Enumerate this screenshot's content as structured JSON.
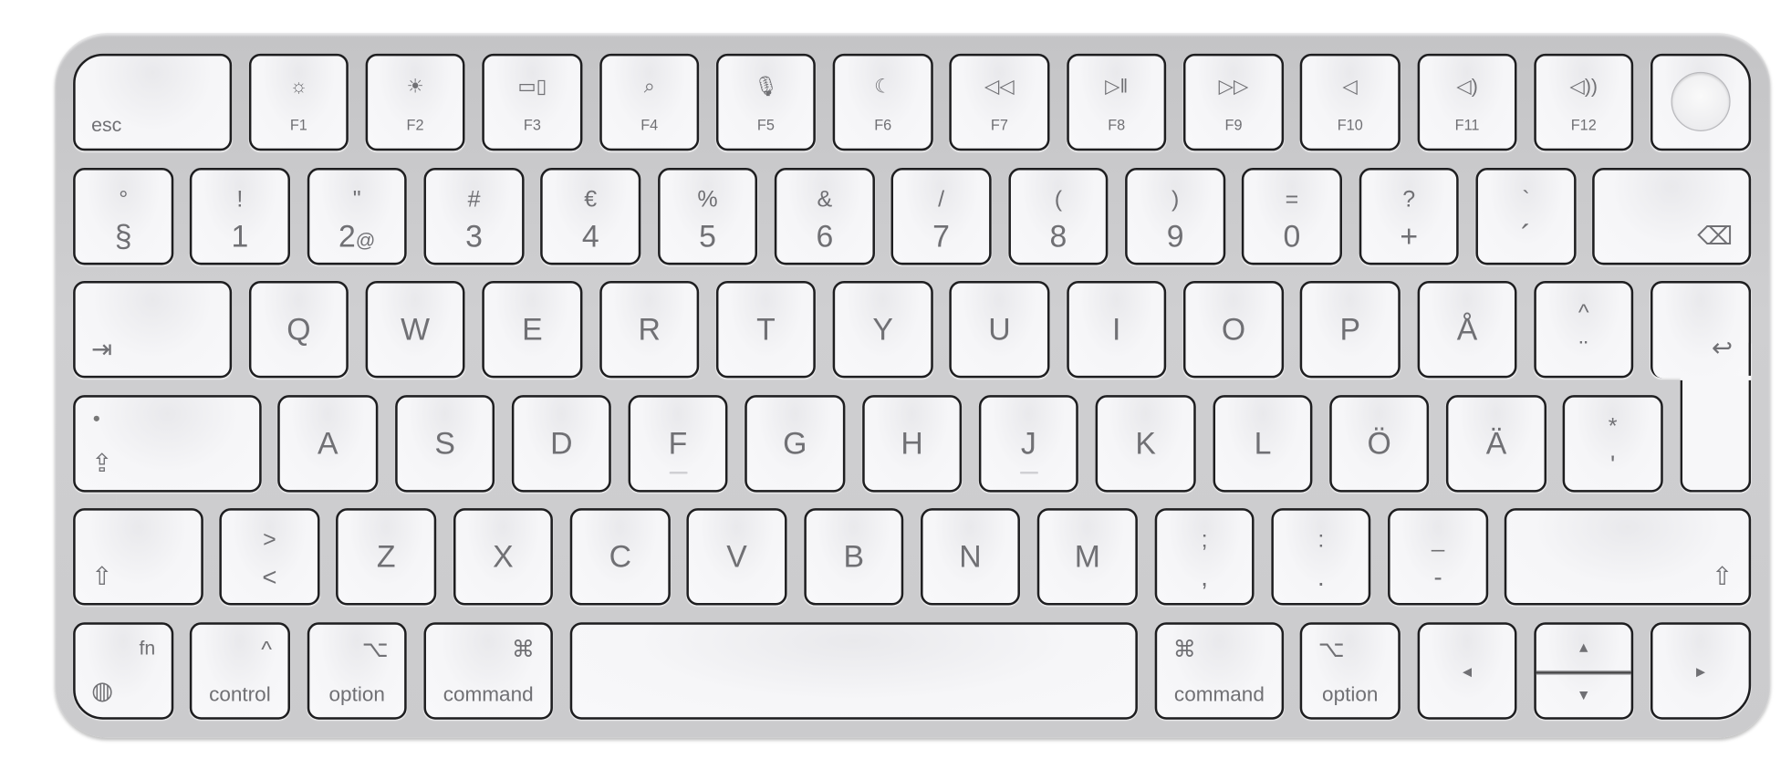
{
  "keyboard": {
    "layout": "Swedish",
    "colors": {
      "body": "#c9c9cb",
      "key": "#f6f6f8",
      "key_border": "#1e1e20",
      "legend": "#707074"
    },
    "rows": [
      {
        "keys": [
          {
            "label": "esc"
          },
          {
            "icon": "brightness-down-icon",
            "fn": "F1"
          },
          {
            "icon": "brightness-up-icon",
            "fn": "F2"
          },
          {
            "icon": "mission-control-icon",
            "fn": "F3"
          },
          {
            "icon": "search-icon",
            "fn": "F4"
          },
          {
            "icon": "microphone-icon",
            "fn": "F5"
          },
          {
            "icon": "moon-icon",
            "fn": "F6"
          },
          {
            "icon": "rewind-icon",
            "fn": "F7"
          },
          {
            "icon": "play-pause-icon",
            "fn": "F8"
          },
          {
            "icon": "fast-forward-icon",
            "fn": "F9"
          },
          {
            "icon": "mute-icon",
            "fn": "F10"
          },
          {
            "icon": "volume-down-icon",
            "fn": "F11"
          },
          {
            "icon": "volume-up-icon",
            "fn": "F12"
          },
          {
            "icon": "touch-id-icon"
          }
        ]
      },
      {
        "keys": [
          {
            "shift": "°",
            "main": "§"
          },
          {
            "shift": "!",
            "main": "1"
          },
          {
            "shift": "\"",
            "main": "2",
            "alt": "@"
          },
          {
            "shift": "#",
            "main": "3"
          },
          {
            "shift": "€",
            "main": "4"
          },
          {
            "shift": "%",
            "main": "5"
          },
          {
            "shift": "&",
            "main": "6"
          },
          {
            "shift": "/",
            "main": "7"
          },
          {
            "shift": "(",
            "main": "8"
          },
          {
            "shift": ")",
            "main": "9"
          },
          {
            "shift": "=",
            "main": "0"
          },
          {
            "shift": "?",
            "main": "+"
          },
          {
            "shift": "`",
            "main": "´"
          },
          {
            "icon": "backspace-icon"
          }
        ]
      },
      {
        "keys": [
          {
            "icon": "tab-icon"
          },
          {
            "letter": "Q"
          },
          {
            "letter": "W"
          },
          {
            "letter": "E"
          },
          {
            "letter": "R"
          },
          {
            "letter": "T"
          },
          {
            "letter": "Y"
          },
          {
            "letter": "U"
          },
          {
            "letter": "I"
          },
          {
            "letter": "O"
          },
          {
            "letter": "P"
          },
          {
            "letter": "Å"
          },
          {
            "shift": "^",
            "main": "¨"
          },
          {
            "icon": "return-icon"
          }
        ]
      },
      {
        "keys": [
          {
            "icon": "caps-lock-icon"
          },
          {
            "letter": "A"
          },
          {
            "letter": "S"
          },
          {
            "letter": "D"
          },
          {
            "letter": "F"
          },
          {
            "letter": "G"
          },
          {
            "letter": "H"
          },
          {
            "letter": "J"
          },
          {
            "letter": "K"
          },
          {
            "letter": "L"
          },
          {
            "letter": "Ö"
          },
          {
            "letter": "Ä"
          },
          {
            "shift": "*",
            "main": "'"
          }
        ]
      },
      {
        "keys": [
          {
            "icon": "shift-icon"
          },
          {
            "shift": ">",
            "main": "<"
          },
          {
            "letter": "Z"
          },
          {
            "letter": "X"
          },
          {
            "letter": "C"
          },
          {
            "letter": "V"
          },
          {
            "letter": "B"
          },
          {
            "letter": "N"
          },
          {
            "letter": "M"
          },
          {
            "shift": ";",
            "main": ","
          },
          {
            "shift": ":",
            "main": "."
          },
          {
            "shift": "_",
            "main": "-"
          },
          {
            "icon": "shift-icon"
          }
        ]
      },
      {
        "keys": [
          {
            "label": "fn",
            "icon": "globe-icon"
          },
          {
            "label": "control",
            "icon": "control-icon"
          },
          {
            "label": "option",
            "icon": "option-icon"
          },
          {
            "label": "command",
            "icon": "command-icon"
          },
          {
            "label": ""
          },
          {
            "label": "command",
            "icon": "command-icon"
          },
          {
            "label": "option",
            "icon": "option-icon"
          },
          {
            "icon": "arrow-left-icon"
          },
          {
            "icon": "arrow-up-icon",
            "icon2": "arrow-down-icon"
          },
          {
            "icon": "arrow-right-icon"
          }
        ]
      }
    ]
  }
}
